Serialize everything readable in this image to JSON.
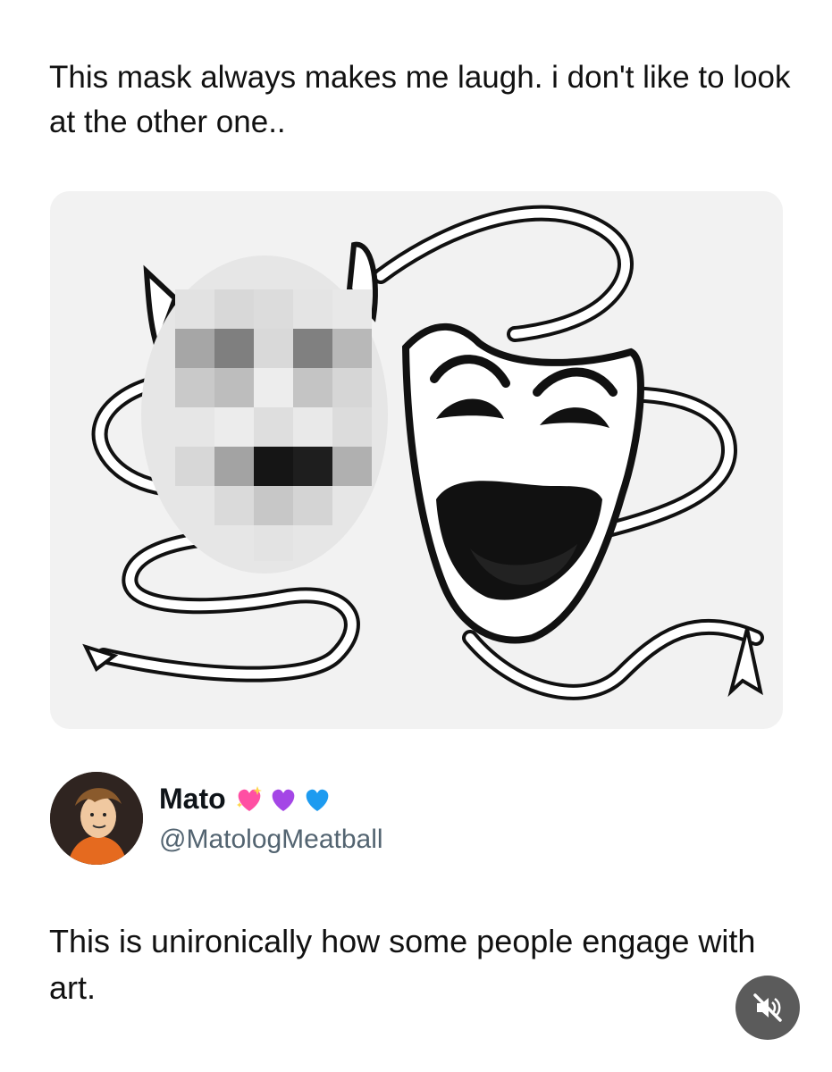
{
  "post": {
    "text": "This mask always makes me laugh. i don't like to look at the other one.."
  },
  "media": {
    "background": "#f2f2f2",
    "left_mask_pixelated": true
  },
  "reply": {
    "author": {
      "name": "Mato",
      "handle": "@MatologMeatball",
      "emoji_icons": [
        "sparkling-heart-icon",
        "purple-heart-icon",
        "blue-heart-icon"
      ],
      "emoji_colors": [
        "#ff4fa3",
        "#a446e6",
        "#1d9bf0"
      ]
    },
    "text": "This is unironically how some people engage with art."
  },
  "controls": {
    "mute_icon": "speaker-muted-icon",
    "button_color": "#5b5b5b"
  }
}
